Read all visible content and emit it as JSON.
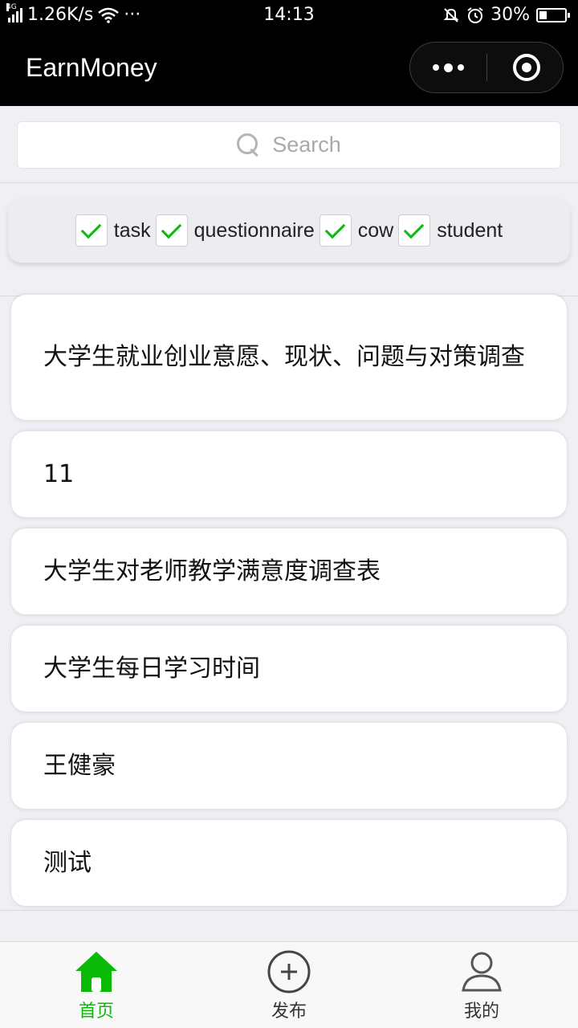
{
  "status_bar": {
    "network": "4G",
    "speed": "1.26K/s",
    "more": "···",
    "time": "14:13",
    "battery": "30%",
    "battery_level": 0.3
  },
  "nav": {
    "title": "EarnMoney"
  },
  "search": {
    "placeholder": "Search"
  },
  "filters": [
    {
      "label": "task",
      "checked": true
    },
    {
      "label": "questionnaire",
      "checked": true
    },
    {
      "label": "cow",
      "checked": true
    },
    {
      "label": "student",
      "checked": true
    }
  ],
  "list": [
    {
      "title": "大学生就业创业意愿、现状、问题与对策调查"
    },
    {
      "title": "11"
    },
    {
      "title": "大学生对老师教学满意度调查表"
    },
    {
      "title": "大学生每日学习时间"
    },
    {
      "title": "王健豪"
    },
    {
      "title": "测试"
    }
  ],
  "tabs": [
    {
      "label": "首页",
      "icon": "home-icon",
      "active": true
    },
    {
      "label": "发布",
      "icon": "plus-circle-icon",
      "active": false
    },
    {
      "label": "我的",
      "icon": "user-icon",
      "active": false
    }
  ],
  "colors": {
    "accent": "#09bb07",
    "nav_bg": "#000000",
    "page_bg": "#efeff4"
  }
}
